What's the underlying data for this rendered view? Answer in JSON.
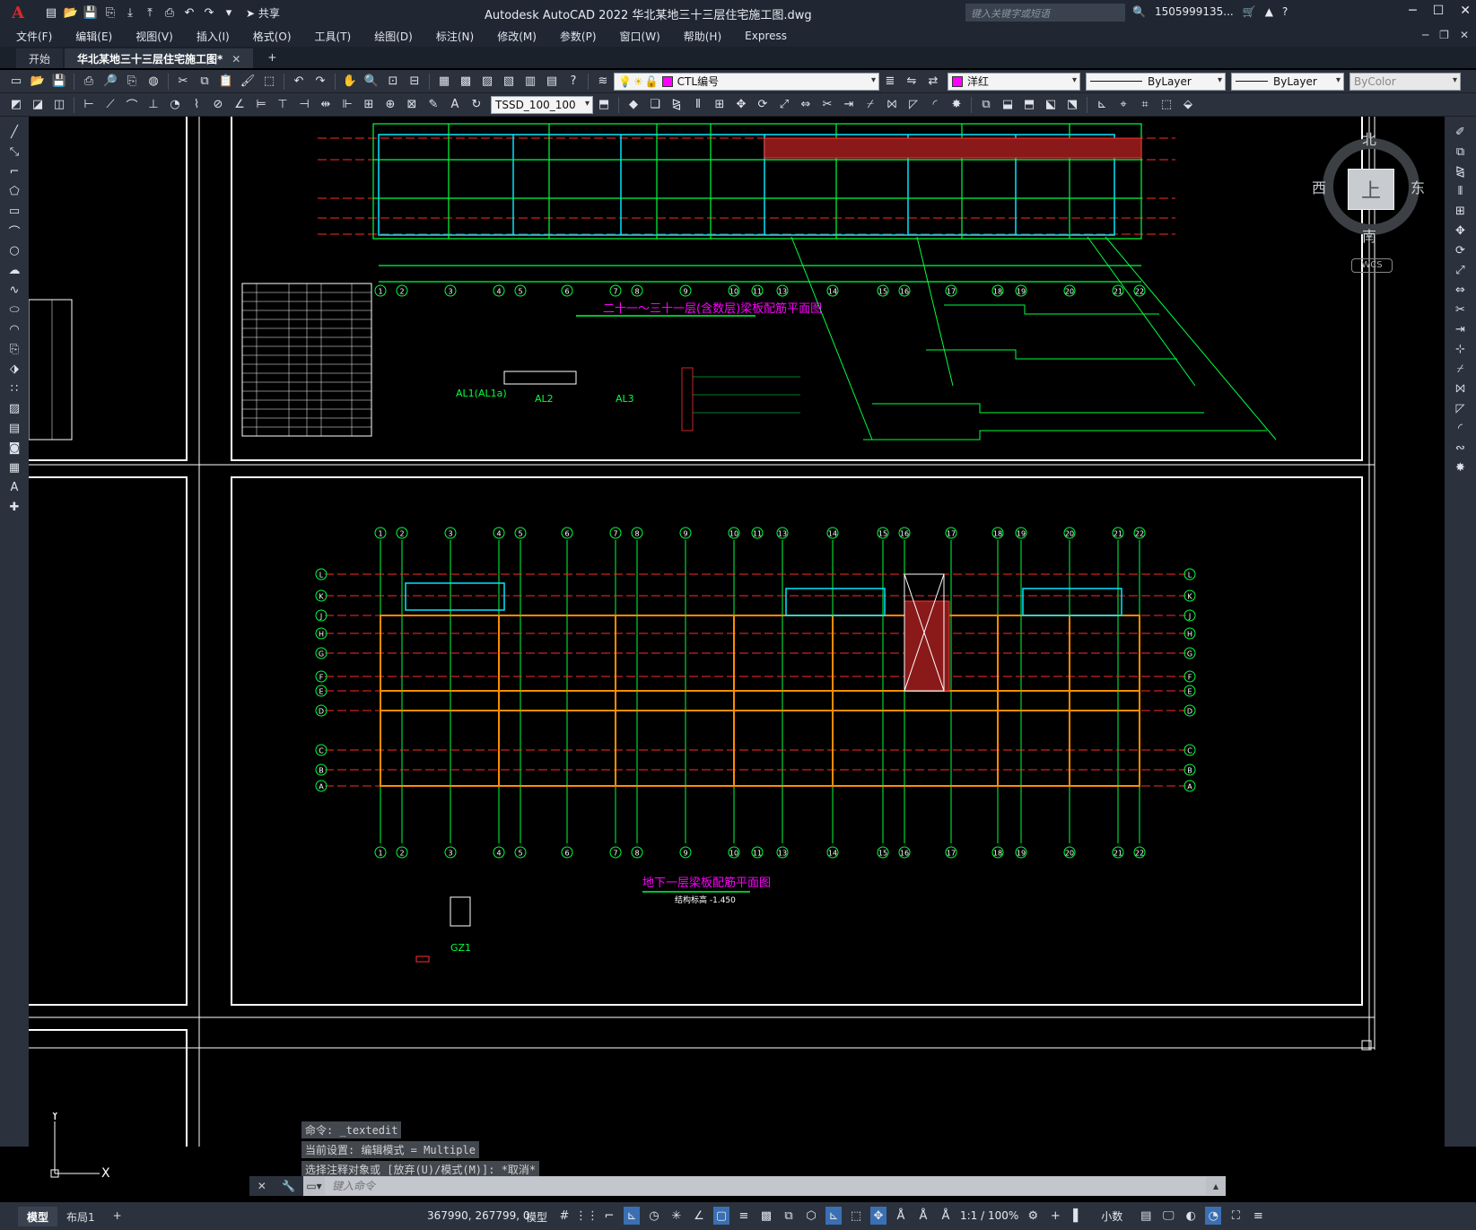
{
  "app": {
    "logo": "A",
    "title": "Autodesk AutoCAD 2022    华北某地三十三层住宅施工图.dwg",
    "share_label": "共享",
    "search_placeholder": "键入关键字或短语",
    "user": "1505999135...",
    "window_controls": [
      "minimize-icon",
      "maximize-icon",
      "close-icon"
    ]
  },
  "menu": [
    "文件(F)",
    "编辑(E)",
    "视图(V)",
    "插入(I)",
    "格式(O)",
    "工具(T)",
    "绘图(D)",
    "标注(N)",
    "修改(M)",
    "参数(P)",
    "窗口(W)",
    "帮助(H)",
    "Express"
  ],
  "tabs": [
    {
      "label": "开始",
      "active": false
    },
    {
      "label": "华北某地三十三层住宅施工图*",
      "active": true
    }
  ],
  "toolbar1": {
    "layer_value": "CTL编号",
    "color_value": "洋红",
    "linetype_value": "ByLayer",
    "lineweight_value": "ByLayer",
    "plotstyle_value": "ByColor",
    "colors": {
      "layer_swatch": "#ff00ff",
      "color_swatch": "#ff00ff"
    }
  },
  "toolbar2": {
    "dimstyle_value": "TSSD_100_100"
  },
  "viewcube": {
    "north": "北",
    "south": "南",
    "east": "东",
    "west": "西",
    "face": "上",
    "wcs": "WCS"
  },
  "drawing": {
    "plan_upper_title": "二十一～三十一层(含数层)梁板配筋平面图",
    "plan_lower_title": "地下一层梁板配筋平面图",
    "plan_lower_elev": "结构标高 -1.450",
    "detail_labels": [
      "AL1(AL1a)",
      "AL2",
      "AL3",
      "GZ1"
    ],
    "bottom_axes": [
      "1",
      "2",
      "3",
      "4",
      "5",
      "6",
      "7",
      "8",
      "9",
      "10",
      "11",
      "13",
      "14",
      "15",
      "16",
      "17",
      "18",
      "19",
      "20",
      "21",
      "22"
    ],
    "row_axes": [
      "L",
      "K",
      "J",
      "H",
      "G",
      "F",
      "E",
      "D",
      "C",
      "B",
      "A"
    ]
  },
  "ucs": {
    "x": "X",
    "y": "Y"
  },
  "command": {
    "history": [
      "命令: _textedit",
      "当前设置: 编辑模式 = Multiple",
      "选择注释对象或 [放弃(U)/模式(M)]: *取消*"
    ],
    "placeholder": "键入命令"
  },
  "status": {
    "layout_tabs": [
      {
        "label": "模型",
        "active": true
      },
      {
        "label": "布局1",
        "active": false
      }
    ],
    "coords": "367990, 267799, 0",
    "mode": "模型",
    "scale": "1:1 / 100%",
    "units": "小数"
  }
}
